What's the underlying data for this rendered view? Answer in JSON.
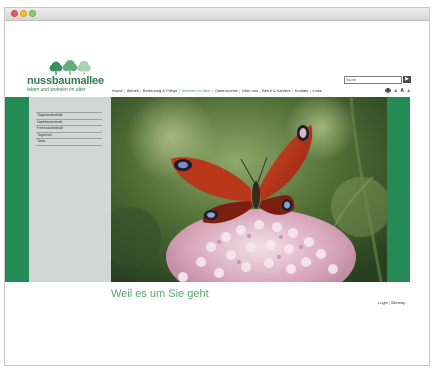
{
  "window": {
    "controls": [
      "close-icon",
      "minimize-icon",
      "maximize-icon"
    ]
  },
  "logo": {
    "name": "nussbaumallee",
    "tagline": "leben und wohnen im alter"
  },
  "search": {
    "value": "Suche",
    "button_icon": "search-arrow-icon",
    "button_label": "▶"
  },
  "nav": {
    "items": [
      {
        "label": "Home"
      },
      {
        "label": "Aktuell"
      },
      {
        "label": "Betreuung & Pflege"
      },
      {
        "label": "Wohnen im Alter"
      },
      {
        "label": "Gastronomie"
      },
      {
        "label": "Über uns"
      },
      {
        "label": "Beruf & Karriere"
      },
      {
        "label": "Kontakt"
      },
      {
        "label": "Links"
      }
    ],
    "active_index": 3
  },
  "tools": {
    "print_icon": "printer-icon",
    "font_sizes": [
      "A",
      "A",
      "A"
    ]
  },
  "sidebar": {
    "items": [
      {
        "label": "Tagesaufenthalt"
      },
      {
        "label": "Nachtaufenthalt"
      },
      {
        "label": "Ferienaufenthalt"
      },
      {
        "label": "Tageshof"
      },
      {
        "label": "Taxis"
      }
    ]
  },
  "hero": {
    "image_subject": "peacock butterfly on pink sedum flowers"
  },
  "tagline": "Weil es um Sie geht",
  "footer": {
    "links": [
      {
        "label": "Login"
      },
      {
        "label": "Sitemap"
      }
    ],
    "separator": "|"
  },
  "colors": {
    "brand_green": "#258b55",
    "logo_green": "#2f7a53",
    "tagline_green": "#5ea36d",
    "sidebar_gray": "#d4d6d5"
  }
}
